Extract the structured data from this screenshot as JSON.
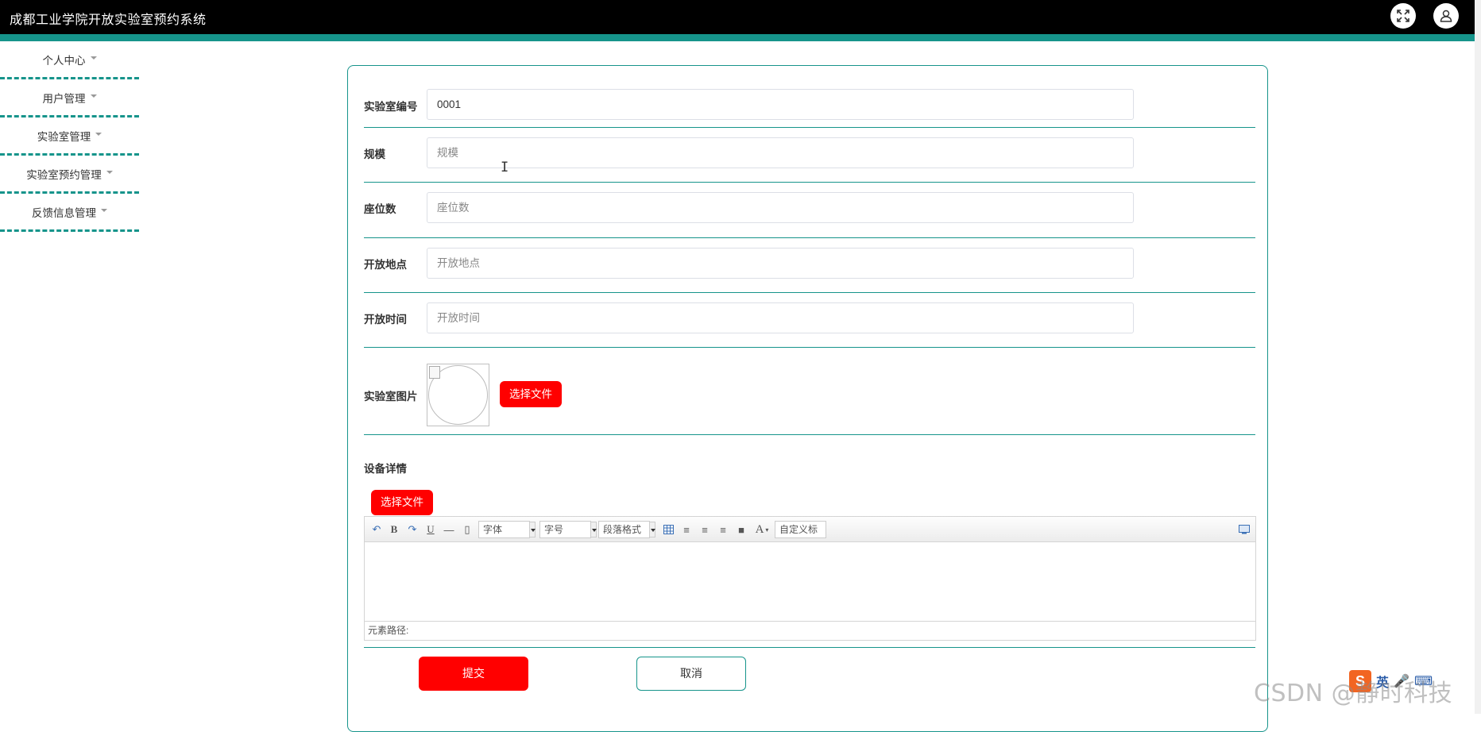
{
  "app": {
    "title": "成都工业学院开放实验室预约系统",
    "accent": "#16948b",
    "danger": "#ff0000"
  },
  "header": {
    "fullscreen_icon": "fullscreen-icon",
    "user_icon": "user-icon"
  },
  "sidebar": {
    "items": [
      {
        "label": "个人中心"
      },
      {
        "label": "用户管理"
      },
      {
        "label": "实验室管理"
      },
      {
        "label": "实验室预约管理"
      },
      {
        "label": "反馈信息管理"
      }
    ]
  },
  "form": {
    "lab_no": {
      "label": "实验室编号",
      "value": "0001"
    },
    "scale": {
      "label": "规模",
      "placeholder": "规模"
    },
    "seats": {
      "label": "座位数",
      "placeholder": "座位数"
    },
    "location": {
      "label": "开放地点",
      "placeholder": "开放地点"
    },
    "open_time": {
      "label": "开放时间",
      "placeholder": "开放时间"
    },
    "image": {
      "label": "实验室图片",
      "choose_file": "选择文件"
    },
    "details": {
      "label": "设备详情",
      "choose_file": "选择文件",
      "toolbar": {
        "font_family": "字体",
        "font_size": "字号",
        "paragraph": "段落格式",
        "custom_title": "自定义标题",
        "bold": "B",
        "underline": "U",
        "font_color": "A"
      },
      "status_path": "元素路径:"
    },
    "submit_label": "提交",
    "cancel_label": "取消"
  },
  "overlay": {
    "watermark": "CSDN @静时科技",
    "ime_label": "英"
  }
}
